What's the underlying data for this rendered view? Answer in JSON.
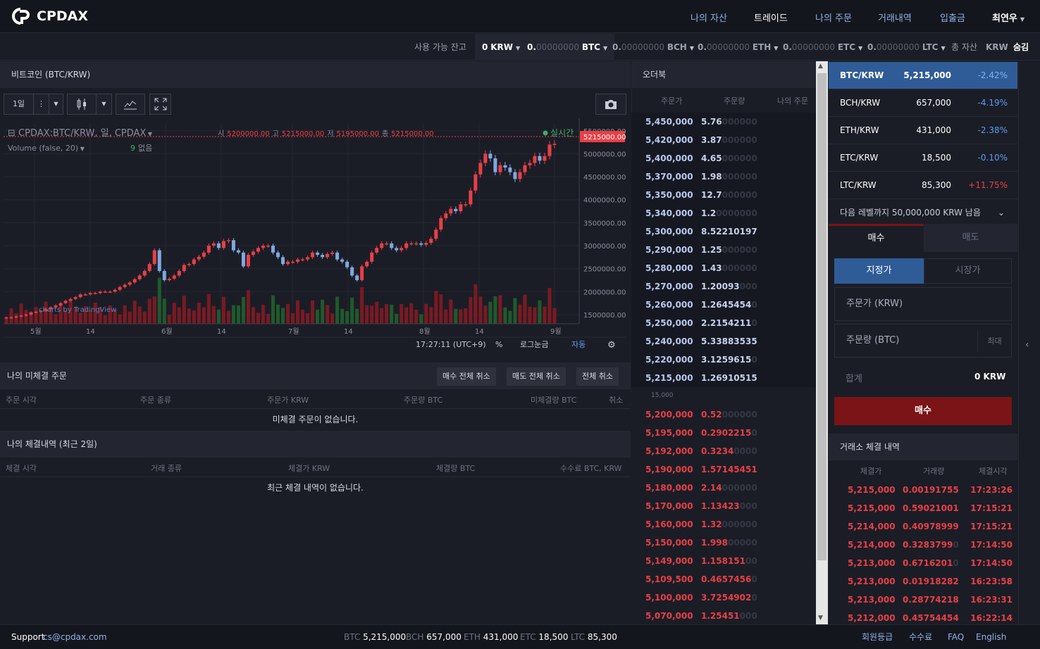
{
  "brand": {
    "name": "CPDAX"
  },
  "nav": {
    "items": [
      "나의 자산",
      "트레이드",
      "나의 주문",
      "거래내역",
      "입출금"
    ],
    "user": "최연우"
  },
  "balance": {
    "label": "사용 가능 잔고",
    "items": [
      {
        "zero": "",
        "val": "0",
        "unit": "KRW"
      },
      {
        "lead": "0.",
        "zero": "00000000",
        "unit": "BTC"
      },
      {
        "lead": "0.",
        "zero": "00000000",
        "unit": "BCH"
      },
      {
        "lead": "0.",
        "zero": "00000000",
        "unit": "ETH"
      },
      {
        "lead": "0.",
        "zero": "00000000",
        "unit": "ETC"
      },
      {
        "lead": "0.",
        "zero": "00000000",
        "unit": "LTC"
      }
    ],
    "total_label": "총 자산",
    "total_unit": "KRW",
    "hide": "숨김"
  },
  "chart_panel": {
    "title": "비트코인 (BTC/KRW)",
    "interval": "1일",
    "legend_main": "CPDAX:BTC/KRW, 일, CPDAX",
    "ohlc": {
      "o_label": "시",
      "o": "5200000.00",
      "h_label": "고",
      "h": "5215000.00",
      "l_label": "저",
      "l": "5195000.00",
      "c_label": "종",
      "c": "5215000.00"
    },
    "volume_label": "Volume (false, 20)",
    "volume_val": "9",
    "volume_none": "없음",
    "realtime": "실시간",
    "price_tag": "5215000.00",
    "watermark": "charts by TradingView",
    "time": "17:27:11 (UTC+9)",
    "pct": "%",
    "log": "로그눈금",
    "auto": "자동"
  },
  "chart_data": {
    "type": "candlestick",
    "title": "",
    "x_ticks": [
      "5월",
      "14",
      "6월",
      "14",
      "7월",
      "14",
      "8월",
      "14",
      "9월"
    ],
    "y_ticks": [
      "5500000.00",
      "5000000.00",
      "4500000.00",
      "4000000.00",
      "3500000.00",
      "3000000.00",
      "2500000.00",
      "2000000.00",
      "1500000.00"
    ],
    "ylim": [
      1300000,
      5650000
    ],
    "close_approx": [
      1440000,
      1440000,
      1460000,
      1480000,
      1500000,
      1550000,
      1560000,
      1580000,
      1620000,
      1660000,
      1700000,
      1750000,
      1800000,
      1840000,
      1880000,
      1940000,
      1940000,
      1970000,
      1970000,
      2000000,
      2000000,
      2000000,
      2040000,
      2100000,
      2150000,
      2200000,
      2270000,
      2350000,
      2450000,
      2600000,
      2900000,
      2450000,
      2250000,
      2280000,
      2350000,
      2450000,
      2580000,
      2600000,
      2700000,
      2760000,
      2850000,
      3000000,
      3050000,
      2950000,
      3100000,
      3120000,
      2900000,
      2850000,
      2550000,
      2800000,
      2870000,
      2950000,
      3000000,
      3000000,
      2850000,
      2750000,
      2600000,
      2650000,
      2650000,
      2700000,
      2700000,
      2750000,
      2850000,
      2800000,
      2750000,
      2820000,
      2850000,
      2700000,
      2650000,
      2530000,
      2350000,
      2250000,
      2550000,
      2650000,
      2850000,
      2950000,
      3050000,
      3050000,
      2950000,
      2900000,
      2950000,
      3050000,
      3050000,
      3050000,
      3020000,
      3060000,
      3150000,
      3350000,
      3600000,
      3700000,
      3800000,
      3750000,
      3900000,
      3900000,
      4200000,
      4550000,
      4800000,
      5000000,
      4900000,
      4600000,
      4750000,
      4700000,
      4600000,
      4450000,
      4600000,
      4750000,
      4800000,
      4950000,
      4850000,
      4950000,
      5200000,
      5215000
    ]
  },
  "orderbook": {
    "title": "오더북",
    "cols": [
      "주문가",
      "주문량",
      "나의 주문"
    ],
    "asks": [
      {
        "p": "5,450,000",
        "q": "5.76",
        "t": "000000"
      },
      {
        "p": "5,420,000",
        "q": "3.87",
        "t": "000000"
      },
      {
        "p": "5,400,000",
        "q": "4.65",
        "t": "000000"
      },
      {
        "p": "5,370,000",
        "q": "1.98",
        "t": "000000"
      },
      {
        "p": "5,350,000",
        "q": "12.7",
        "t": "000000"
      },
      {
        "p": "5,340,000",
        "q": "1.2",
        "t": "0000000"
      },
      {
        "p": "5,300,000",
        "q": "8.52210197",
        "t": ""
      },
      {
        "p": "5,290,000",
        "q": "1.25",
        "t": "000000"
      },
      {
        "p": "5,280,000",
        "q": "1.43",
        "t": "000000"
      },
      {
        "p": "5,270,000",
        "q": "1.20093",
        "t": "000"
      },
      {
        "p": "5,260,000",
        "q": "1.2645454",
        "t": "0"
      },
      {
        "p": "5,250,000",
        "q": "2.2154211",
        "t": "0"
      },
      {
        "p": "5,240,000",
        "q": "5.33883535",
        "t": ""
      },
      {
        "p": "5,220,000",
        "q": "3.1259615",
        "t": "0"
      },
      {
        "p": "5,215,000",
        "q": "1.26910515",
        "t": ""
      }
    ],
    "spread": "15,000",
    "bids": [
      {
        "p": "5,200,000",
        "q": "0.52",
        "t": "000000"
      },
      {
        "p": "5,195,000",
        "q": "0.2902215",
        "t": "0"
      },
      {
        "p": "5,192,000",
        "q": "0.3234",
        "t": "0000"
      },
      {
        "p": "5,190,000",
        "q": "1.57145451",
        "t": ""
      },
      {
        "p": "5,180,000",
        "q": "2.14",
        "t": "000000"
      },
      {
        "p": "5,170,000",
        "q": "1.13423",
        "t": "000"
      },
      {
        "p": "5,160,000",
        "q": "1.32",
        "t": "000000"
      },
      {
        "p": "5,150,000",
        "q": "1.998",
        "t": "00000"
      },
      {
        "p": "5,149,000",
        "q": "1.158151",
        "t": "00"
      },
      {
        "p": "5,109,500",
        "q": "0.4657456",
        "t": "0"
      },
      {
        "p": "5,100,000",
        "q": "3.7254902",
        "t": "0"
      },
      {
        "p": "5,070,000",
        "q": "1.25451",
        "t": "000"
      }
    ]
  },
  "markets": [
    {
      "name": "BTC/KRW",
      "price": "5,215,000",
      "change": "-2.42%",
      "dir": "dn"
    },
    {
      "name": "BCH/KRW",
      "price": "657,000",
      "change": "-4.19%",
      "dir": "dn"
    },
    {
      "name": "ETH/KRW",
      "price": "431,000",
      "change": "-2.38%",
      "dir": "dn"
    },
    {
      "name": "ETC/KRW",
      "price": "18,500",
      "change": "-0.10%",
      "dir": "dn"
    },
    {
      "name": "LTC/KRW",
      "price": "85,300",
      "change": "+11.75%",
      "dir": "up"
    }
  ],
  "level_notice": "다음 레벨까지 50,000,000 KRW 남음",
  "trade_form": {
    "tab_buy": "매수",
    "tab_sell": "매도",
    "limit": "지정가",
    "market": "시장가",
    "price_ph": "주문가 (KRW)",
    "qty_ph": "주문량 (BTC)",
    "max": "최대",
    "total_label": "합계",
    "total_val": "0 KRW",
    "submit": "매수"
  },
  "trades": {
    "title": "거래소 체결 내역",
    "cols": [
      "체결가",
      "거래량",
      "체결시각"
    ],
    "rows": [
      {
        "p": "5,215,000",
        "q": "0.00191755",
        "t": "",
        "time": "17:23:26"
      },
      {
        "p": "5,215,000",
        "q": "0.59021001",
        "t": "",
        "time": "17:15:21"
      },
      {
        "p": "5,214,000",
        "q": "0.40978999",
        "t": "",
        "time": "17:15:21"
      },
      {
        "p": "5,214,000",
        "q": "0.3283799",
        "t": "0",
        "time": "17:14:50"
      },
      {
        "p": "5,213,000",
        "q": "0.6716201",
        "t": "0",
        "time": "17:14:50"
      },
      {
        "p": "5,213,000",
        "q": "0.01918282",
        "t": "",
        "time": "16:23:58"
      },
      {
        "p": "5,213,000",
        "q": "0.28774218",
        "t": "",
        "time": "16:23:31"
      },
      {
        "p": "5,212,000",
        "q": "0.45754454",
        "t": "",
        "time": "16:22:14"
      }
    ]
  },
  "open_orders": {
    "title": "나의 미체결 주문",
    "buttons": [
      "매수 전체 취소",
      "매도 전체 취소",
      "전체 취소"
    ],
    "cols": [
      "주문 시각",
      "주문 종류",
      "주문가 KRW",
      "주문량 BTC",
      "미체결량 BTC",
      "취소"
    ],
    "empty": "미체결 주문이 없습니다."
  },
  "fills": {
    "title": "나의 체결내역 (최근 2일)",
    "cols": [
      "체결 시각",
      "거래 종류",
      "체결가 KRW",
      "체결량 BTC",
      "수수료 BTC, KRW"
    ],
    "empty": "최근 체결 내역이 없습니다."
  },
  "footer": {
    "support_label": "Support",
    "email": "cs@cpdax.com",
    "tickers": [
      {
        "c": "BTC",
        "v": "5,215,000"
      },
      {
        "c": "BCH",
        "v": "657,000"
      },
      {
        "c": "ETH",
        "v": "431,000"
      },
      {
        "c": "ETC",
        "v": "18,500"
      },
      {
        "c": "LTC",
        "v": "85,300"
      }
    ],
    "links": [
      "회원등급",
      "수수료",
      "FAQ",
      "English"
    ]
  },
  "colors": {
    "up": "#ea3f46",
    "down": "#5d9cf0",
    "accent": "#2f5c97",
    "buy_button": "#7a1416"
  }
}
